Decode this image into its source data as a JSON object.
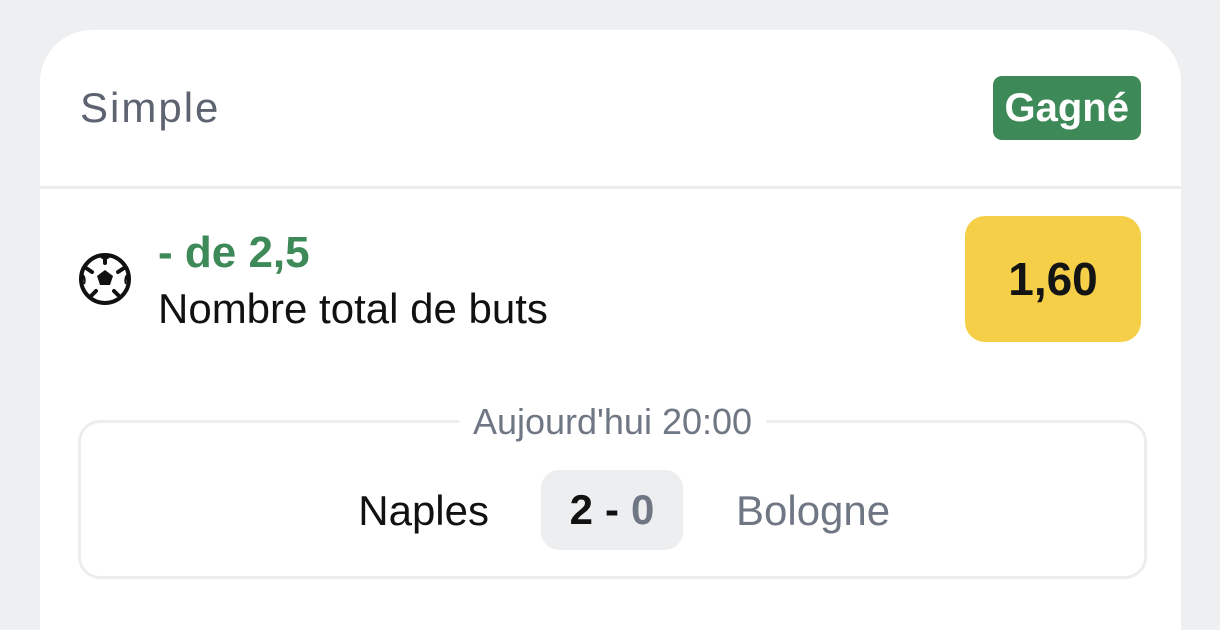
{
  "bet": {
    "type_label": "Simple",
    "status": "Gagné",
    "status_color": "#3d8a58"
  },
  "selection": {
    "sport_icon": "soccer-ball-icon",
    "pick": "- de 2,5",
    "market": "Nombre total de buts",
    "odds": "1,60",
    "odds_color": "#f5cf48"
  },
  "match": {
    "time": "Aujourd'hui 20:00",
    "home_team": "Naples",
    "away_team": "Bologne",
    "score_home": "2",
    "score_separator": "-",
    "score_away": "0"
  }
}
